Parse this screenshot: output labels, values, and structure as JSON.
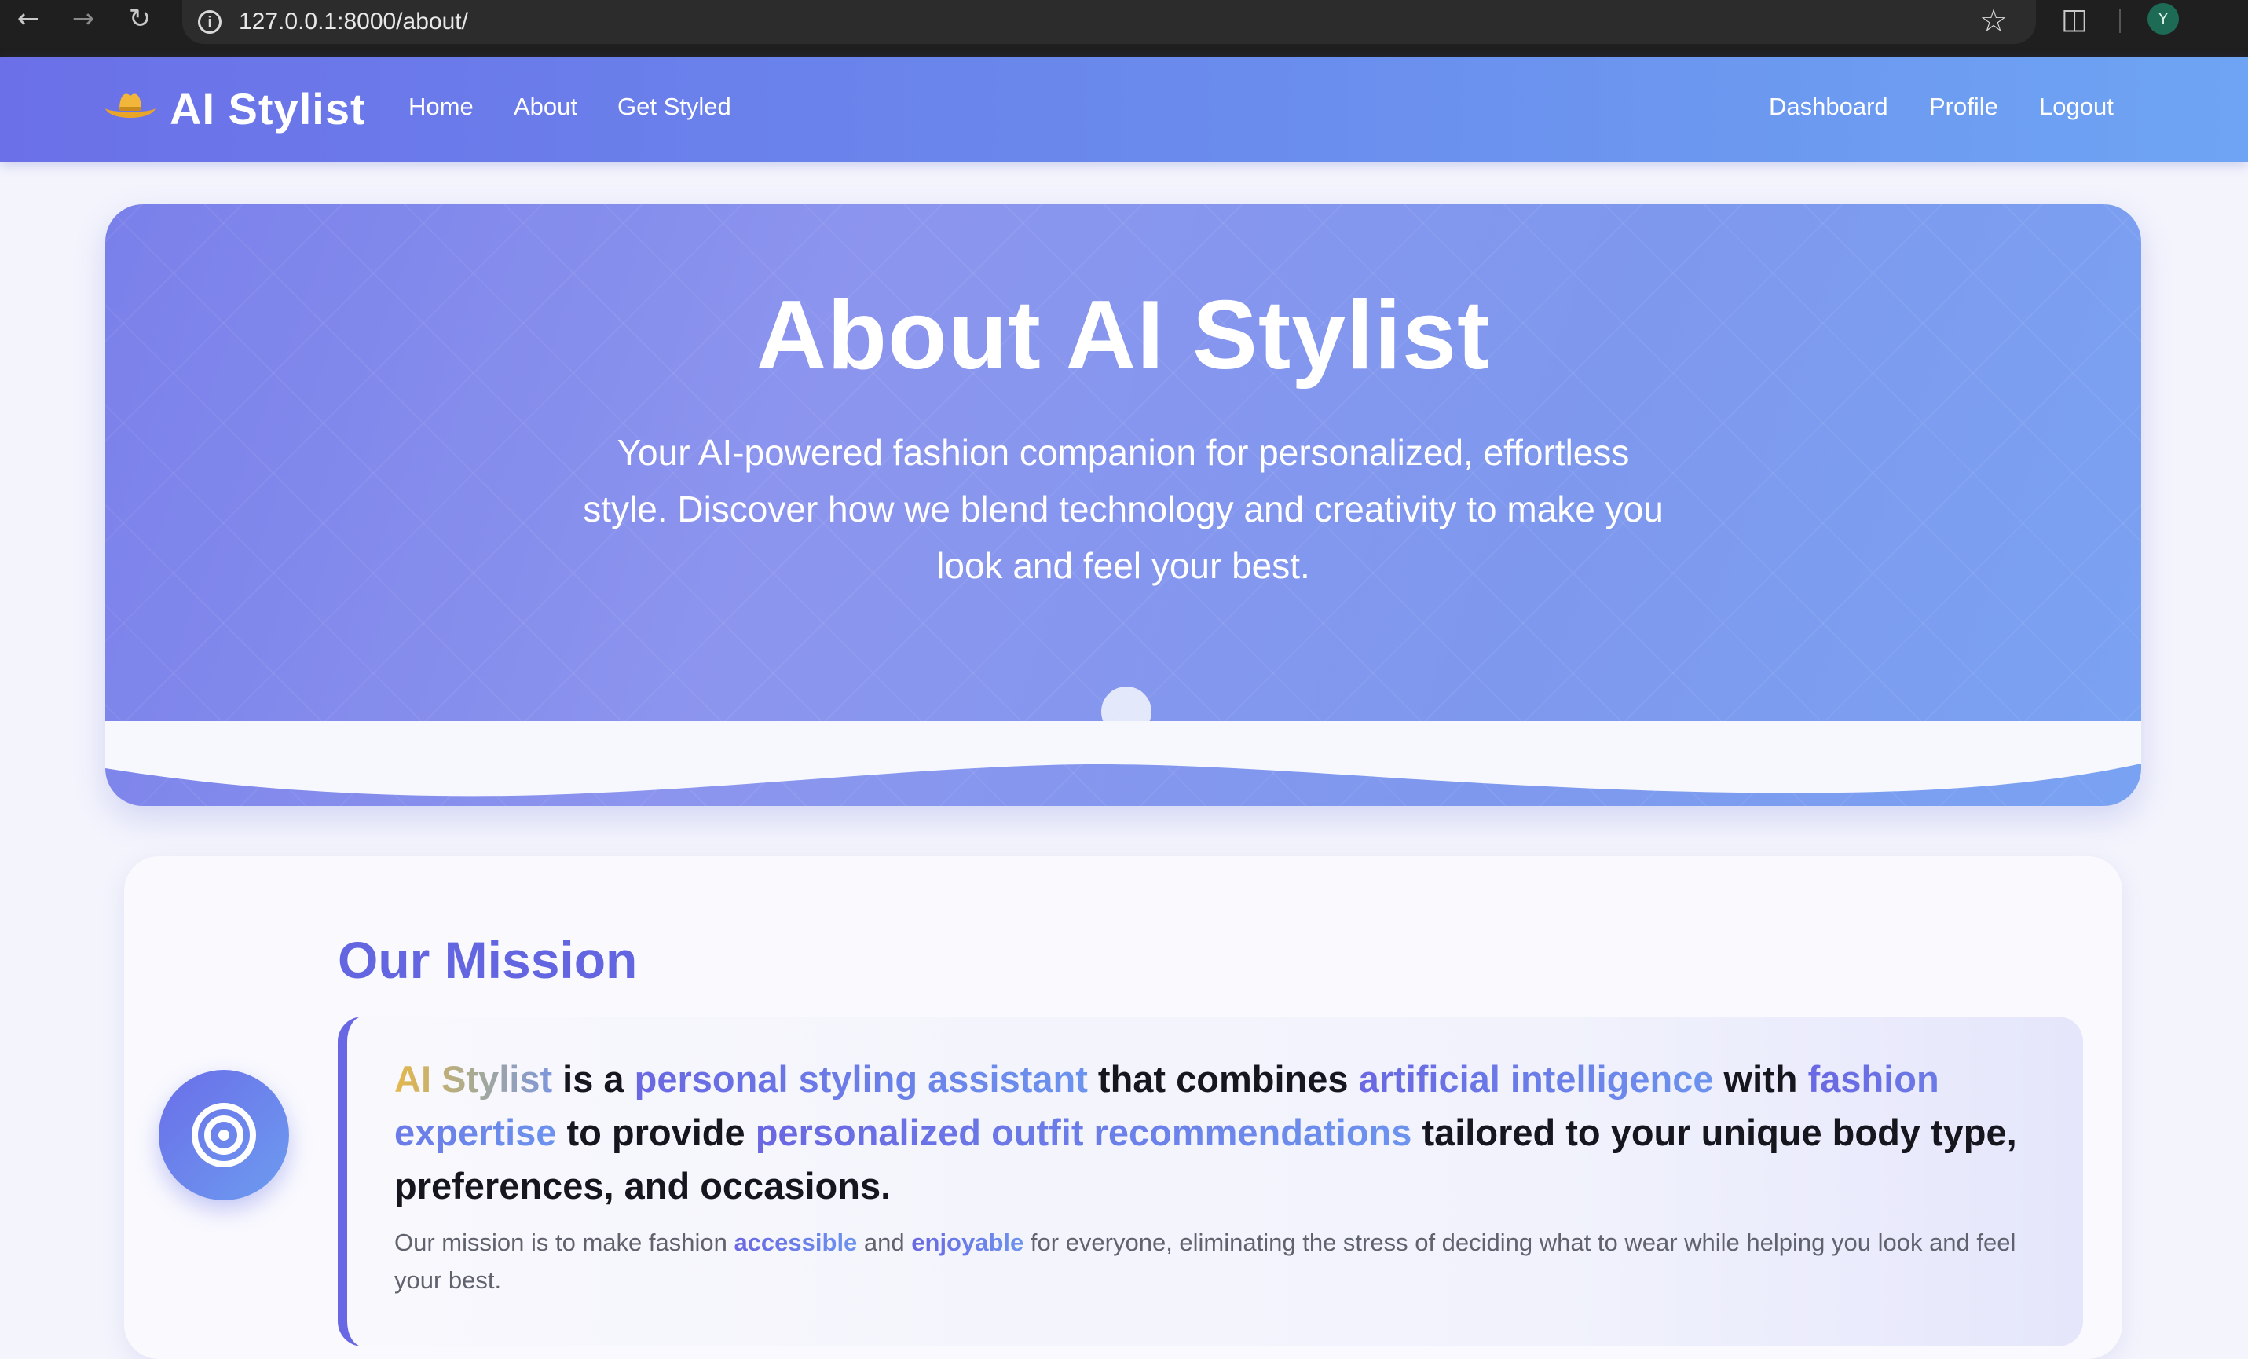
{
  "browser": {
    "url": "127.0.0.1:8000/about/",
    "profile_initial": "Y"
  },
  "nav": {
    "brand": "AI Stylist",
    "left_links": [
      "Home",
      "About",
      "Get Styled"
    ],
    "right_links": [
      "Dashboard",
      "Profile",
      "Logout"
    ]
  },
  "hero": {
    "title": "About AI Stylist",
    "subtitle": "Your AI-powered fashion companion for personalized, effortless style. Discover how we blend technology and creativity to make you look and feel your best."
  },
  "mission": {
    "title": "Our Mission",
    "lead": {
      "brand": "AI Stylist",
      "t1": " is a ",
      "h1": "personal styling assistant",
      "t2": " that combines ",
      "h2": "artificial intelligence",
      "t3": " with ",
      "h3": "fashion expertise",
      "t4": " to provide ",
      "h4": "personalized outfit recommendations",
      "t5": " tailored to your unique body type, preferences, and occasions."
    },
    "body": {
      "t1": "Our mission is to make fashion ",
      "e1": "accessible",
      "t2": " and ",
      "e2": "enjoyable",
      "t3": " for everyone, eliminating the stress of deciding what to wear while helping you look and feel your best."
    }
  },
  "colors": {
    "nav_start": "#6b70e8",
    "nav_end": "#6ea4f3",
    "accent": "#6366e0",
    "hat": "#f2b63a"
  },
  "icons": {
    "back": "arrow-left-icon",
    "forward": "arrow-right-icon",
    "reload": "reload-icon",
    "info": "info-icon",
    "bookmark": "star-icon",
    "extensions": "puzzle-icon",
    "brand": "cowboy-hat-icon",
    "mission": "target-icon"
  }
}
